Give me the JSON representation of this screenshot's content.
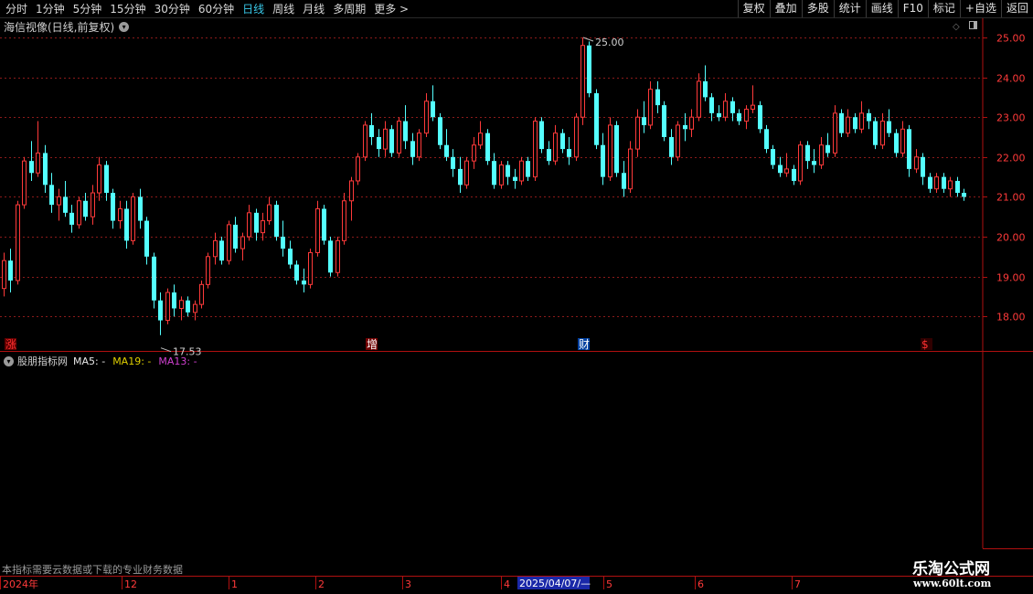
{
  "toolbar": {
    "periods": [
      "分时",
      "1分钟",
      "5分钟",
      "15分钟",
      "30分钟",
      "60分钟",
      "日线",
      "周线",
      "月线",
      "多周期",
      "更多 >"
    ],
    "active_period": "日线",
    "right_buttons": [
      "复权",
      "叠加",
      "多股",
      "统计",
      "画线",
      "F10",
      "标记",
      "+自选",
      "返回"
    ]
  },
  "main_chart": {
    "title": "海信视像(日线,前复权)",
    "high_label": "25.00",
    "low_label": "17.53",
    "price_ticks": [
      "25.00",
      "24.00",
      "23.00",
      "22.00",
      "21.00",
      "20.00",
      "19.00",
      "18.00"
    ],
    "markers": [
      {
        "text": "涨",
        "color": "#ff3030",
        "bg": "#600000"
      },
      {
        "text": "增",
        "color": "#ffffff",
        "bg": "#700000"
      },
      {
        "text": "财",
        "color": "#ffffff",
        "bg": "#0040a0"
      },
      {
        "text": "$",
        "color": "#ff3030",
        "bg": "#300000"
      }
    ]
  },
  "indicator_panel": {
    "name": "股朋指标网",
    "ma5": "MA5: -",
    "ma19": "MA19: -",
    "ma13": "MA13: -",
    "note": "本指标需要云数据或下载的专业财务数据"
  },
  "time_axis": {
    "labels": [
      "2024年",
      "12",
      "1",
      "2",
      "3",
      "4",
      "5",
      "6",
      "7"
    ],
    "cursor_date": "2025/04/07/—"
  },
  "watermark": {
    "title": "乐淘公式网",
    "url": "www.60lt.com"
  },
  "colors": {
    "up": "#ff3a3a",
    "down": "#54ffff",
    "grid": "#8b1a1a",
    "axis": "#b01010",
    "active": "#39c8e8"
  },
  "chart_data": {
    "type": "candlestick",
    "title": "海信视像(日线,前复权)",
    "ylim": [
      17.2,
      25.3
    ],
    "yticks": [
      18,
      19,
      20,
      21,
      22,
      23,
      24,
      25
    ],
    "x_labels": [
      "2024年",
      "12",
      "1",
      "2",
      "3",
      "4",
      "5",
      "6",
      "7"
    ],
    "high": 25.0,
    "low": 17.53,
    "ohlc": [
      [
        18.7,
        19.6,
        18.5,
        19.4
      ],
      [
        19.4,
        19.7,
        18.6,
        18.9
      ],
      [
        18.9,
        20.9,
        18.8,
        20.8
      ],
      [
        20.8,
        22.0,
        20.7,
        21.9
      ],
      [
        21.9,
        22.4,
        21.4,
        21.6
      ],
      [
        21.6,
        22.9,
        21.5,
        22.1
      ],
      [
        22.1,
        22.3,
        21.1,
        21.3
      ],
      [
        21.3,
        21.6,
        20.6,
        20.8
      ],
      [
        20.8,
        21.2,
        20.4,
        21.0
      ],
      [
        21.0,
        21.4,
        20.5,
        20.6
      ],
      [
        20.6,
        20.8,
        20.1,
        20.3
      ],
      [
        20.3,
        21.0,
        20.2,
        20.9
      ],
      [
        20.9,
        21.1,
        20.4,
        20.5
      ],
      [
        20.5,
        21.3,
        20.3,
        21.1
      ],
      [
        21.1,
        22.0,
        20.9,
        21.8
      ],
      [
        21.8,
        21.9,
        20.9,
        21.1
      ],
      [
        21.1,
        21.2,
        20.2,
        20.4
      ],
      [
        20.4,
        20.9,
        20.2,
        20.7
      ],
      [
        20.7,
        20.9,
        19.7,
        19.9
      ],
      [
        19.9,
        21.1,
        19.8,
        21.0
      ],
      [
        21.0,
        21.2,
        20.2,
        20.4
      ],
      [
        20.4,
        20.5,
        19.3,
        19.5
      ],
      [
        19.5,
        19.6,
        18.2,
        18.4
      ],
      [
        18.4,
        18.6,
        17.53,
        17.9
      ],
      [
        17.9,
        18.7,
        17.8,
        18.6
      ],
      [
        18.6,
        18.8,
        18.0,
        18.2
      ],
      [
        18.2,
        18.5,
        17.9,
        18.4
      ],
      [
        18.4,
        18.5,
        18.0,
        18.1
      ],
      [
        18.1,
        18.4,
        17.9,
        18.3
      ],
      [
        18.3,
        18.9,
        18.2,
        18.8
      ],
      [
        18.8,
        19.6,
        18.7,
        19.5
      ],
      [
        19.5,
        20.1,
        19.3,
        19.9
      ],
      [
        19.9,
        20.0,
        19.3,
        19.4
      ],
      [
        19.4,
        20.4,
        19.3,
        20.3
      ],
      [
        20.3,
        20.5,
        19.6,
        19.7
      ],
      [
        19.7,
        20.1,
        19.4,
        20.0
      ],
      [
        20.0,
        20.8,
        19.9,
        20.6
      ],
      [
        20.6,
        20.7,
        19.9,
        20.1
      ],
      [
        20.1,
        20.6,
        19.9,
        20.4
      ],
      [
        20.4,
        21.0,
        20.3,
        20.8
      ],
      [
        20.8,
        20.9,
        19.9,
        20.0
      ],
      [
        20.0,
        20.4,
        19.5,
        19.7
      ],
      [
        19.7,
        19.9,
        19.2,
        19.3
      ],
      [
        19.3,
        19.4,
        18.8,
        18.9
      ],
      [
        18.9,
        19.2,
        18.6,
        18.8
      ],
      [
        18.8,
        19.7,
        18.7,
        19.6
      ],
      [
        19.6,
        20.9,
        19.5,
        20.7
      ],
      [
        20.7,
        20.8,
        19.8,
        19.9
      ],
      [
        19.9,
        20.0,
        19.0,
        19.1
      ],
      [
        19.1,
        20.0,
        19.0,
        19.9
      ],
      [
        19.9,
        21.1,
        19.8,
        20.9
      ],
      [
        20.9,
        21.5,
        20.4,
        21.4
      ],
      [
        21.4,
        22.1,
        21.3,
        22.0
      ],
      [
        22.0,
        22.9,
        21.9,
        22.8
      ],
      [
        22.8,
        23.1,
        22.3,
        22.5
      ],
      [
        22.5,
        22.7,
        22.0,
        22.2
      ],
      [
        22.2,
        22.9,
        22.0,
        22.7
      ],
      [
        22.7,
        22.8,
        22.0,
        22.1
      ],
      [
        22.1,
        23.0,
        22.0,
        22.9
      ],
      [
        22.9,
        23.3,
        22.2,
        22.4
      ],
      [
        22.4,
        22.6,
        21.8,
        22.0
      ],
      [
        22.0,
        22.7,
        21.9,
        22.6
      ],
      [
        22.6,
        23.6,
        22.5,
        23.4
      ],
      [
        23.4,
        23.8,
        22.9,
        23.0
      ],
      [
        23.0,
        23.1,
        22.2,
        22.3
      ],
      [
        22.3,
        22.7,
        21.9,
        22.0
      ],
      [
        22.0,
        22.2,
        21.5,
        21.7
      ],
      [
        21.7,
        22.0,
        21.1,
        21.3
      ],
      [
        21.3,
        22.0,
        21.2,
        21.9
      ],
      [
        21.9,
        22.5,
        21.7,
        22.3
      ],
      [
        22.3,
        22.9,
        22.2,
        22.6
      ],
      [
        22.6,
        22.7,
        21.8,
        21.9
      ],
      [
        21.9,
        22.1,
        21.2,
        21.3
      ],
      [
        21.3,
        21.9,
        21.2,
        21.8
      ],
      [
        21.8,
        21.9,
        21.3,
        21.5
      ],
      [
        21.5,
        21.7,
        21.2,
        21.4
      ],
      [
        21.4,
        22.0,
        21.3,
        21.9
      ],
      [
        21.9,
        22.0,
        21.4,
        21.5
      ],
      [
        21.5,
        23.0,
        21.4,
        22.9
      ],
      [
        22.9,
        23.0,
        22.1,
        22.2
      ],
      [
        22.2,
        22.4,
        21.8,
        21.9
      ],
      [
        21.9,
        22.8,
        21.8,
        22.6
      ],
      [
        22.6,
        22.7,
        22.1,
        22.2
      ],
      [
        22.2,
        22.5,
        21.8,
        22.0
      ],
      [
        22.0,
        23.1,
        21.9,
        23.0
      ],
      [
        23.0,
        25.0,
        22.8,
        24.8
      ],
      [
        24.8,
        24.9,
        23.5,
        23.6
      ],
      [
        23.6,
        23.7,
        22.2,
        22.3
      ],
      [
        22.3,
        22.6,
        21.3,
        21.5
      ],
      [
        21.5,
        23.0,
        21.4,
        22.8
      ],
      [
        22.8,
        22.9,
        21.5,
        21.6
      ],
      [
        21.6,
        21.9,
        21.0,
        21.2
      ],
      [
        21.2,
        22.4,
        21.1,
        22.2
      ],
      [
        22.2,
        23.2,
        22.0,
        23.0
      ],
      [
        23.0,
        23.4,
        22.6,
        22.8
      ],
      [
        22.8,
        23.9,
        22.7,
        23.7
      ],
      [
        23.7,
        23.9,
        23.1,
        23.3
      ],
      [
        23.3,
        23.4,
        22.4,
        22.5
      ],
      [
        22.5,
        22.7,
        21.8,
        22.0
      ],
      [
        22.0,
        22.9,
        21.9,
        22.8
      ],
      [
        22.8,
        23.1,
        22.4,
        22.7
      ],
      [
        22.7,
        23.2,
        22.5,
        23.0
      ],
      [
        23.0,
        24.1,
        22.9,
        23.9
      ],
      [
        23.9,
        24.3,
        23.4,
        23.5
      ],
      [
        23.5,
        23.6,
        22.9,
        23.1
      ],
      [
        23.1,
        23.3,
        22.9,
        23.0
      ],
      [
        23.0,
        23.6,
        22.9,
        23.4
      ],
      [
        23.4,
        23.5,
        22.9,
        23.1
      ],
      [
        23.1,
        23.2,
        22.8,
        22.9
      ],
      [
        22.9,
        23.3,
        22.7,
        23.2
      ],
      [
        23.2,
        23.8,
        23.1,
        23.3
      ],
      [
        23.3,
        23.4,
        22.6,
        22.7
      ],
      [
        22.7,
        22.8,
        22.1,
        22.2
      ],
      [
        22.2,
        22.3,
        21.7,
        21.8
      ],
      [
        21.8,
        22.0,
        21.5,
        21.6
      ],
      [
        21.6,
        22.1,
        21.5,
        21.7
      ],
      [
        21.7,
        21.8,
        21.3,
        21.4
      ],
      [
        21.4,
        22.4,
        21.3,
        22.3
      ],
      [
        22.3,
        22.4,
        21.7,
        21.9
      ],
      [
        21.9,
        22.2,
        21.6,
        21.8
      ],
      [
        21.8,
        22.5,
        21.7,
        22.3
      ],
      [
        22.3,
        22.6,
        22.0,
        22.1
      ],
      [
        22.1,
        23.3,
        22.0,
        23.1
      ],
      [
        23.1,
        23.2,
        22.5,
        22.6
      ],
      [
        22.6,
        23.2,
        22.5,
        23.0
      ],
      [
        23.0,
        23.1,
        22.6,
        22.7
      ],
      [
        22.7,
        23.4,
        22.6,
        23.1
      ],
      [
        23.1,
        23.2,
        22.7,
        22.9
      ],
      [
        22.9,
        23.0,
        22.2,
        22.3
      ],
      [
        22.3,
        23.1,
        22.2,
        22.9
      ],
      [
        22.9,
        23.2,
        22.5,
        22.6
      ],
      [
        22.6,
        22.7,
        22.0,
        22.1
      ],
      [
        22.1,
        22.9,
        22.0,
        22.7
      ],
      [
        22.7,
        22.8,
        21.5,
        21.7
      ],
      [
        21.7,
        22.2,
        21.6,
        22.0
      ],
      [
        22.0,
        22.1,
        21.3,
        21.5
      ],
      [
        21.5,
        21.6,
        21.1,
        21.2
      ],
      [
        21.2,
        21.6,
        21.1,
        21.5
      ],
      [
        21.5,
        21.6,
        21.1,
        21.2
      ],
      [
        21.2,
        21.5,
        21.0,
        21.4
      ],
      [
        21.4,
        21.5,
        21.0,
        21.1
      ],
      [
        21.1,
        21.2,
        20.9,
        21.0
      ]
    ]
  }
}
